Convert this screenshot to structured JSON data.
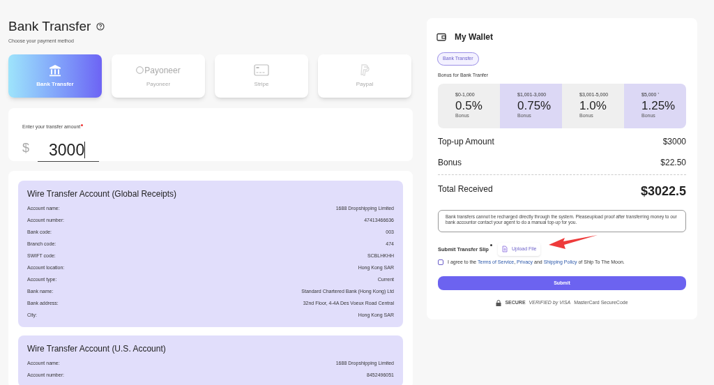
{
  "page": {
    "title": "Bank Transfer",
    "subtitle": "Choose your payment method"
  },
  "methods": [
    {
      "kind": "bank",
      "label": "Bank Transfer",
      "selected": true
    },
    {
      "kind": "payoneer",
      "logo_text": "Payoneer",
      "label": "Payoneer",
      "selected": false
    },
    {
      "kind": "stripe",
      "label": "Stripe",
      "selected": false
    },
    {
      "kind": "paypal",
      "label": "Paypal",
      "selected": false
    }
  ],
  "amount": {
    "label": "Enter your transfer amount",
    "required": true,
    "currency": "$",
    "value": "3000"
  },
  "accounts": [
    {
      "title": "Wire Transfer Account (Global Receipts)",
      "rows": [
        {
          "label": "Account name:",
          "value": "1688 Dropshipping Limited"
        },
        {
          "label": "Account number:",
          "value": "47413466636"
        },
        {
          "label": "Bank code:",
          "value": "003"
        },
        {
          "label": "Branch code:",
          "value": "474"
        },
        {
          "label": "SWIFT code:",
          "value": "SCBLHKHH"
        },
        {
          "label": "Account location:",
          "value": "Hong Kong SAR"
        },
        {
          "label": "Account type:",
          "value": "Current"
        },
        {
          "label": "Bank name:",
          "value": "Standard Chartered Bank (Hong Kong) Ltd"
        },
        {
          "label": "Bank address:",
          "value": "32nd Floor, 4-4A Des Voeux Road Central"
        },
        {
          "label": "City:",
          "value": "Hong Kong SAR"
        }
      ]
    },
    {
      "title": "Wire Transfer Account (U.S. Account)",
      "rows": [
        {
          "label": "Account name:",
          "value": "1688 Dropshipping Limited"
        },
        {
          "label": "Account number:",
          "value": "8452496051"
        }
      ]
    }
  ],
  "wallet": {
    "title": "My Wallet",
    "method_tag": "Bank Transfer",
    "bonus_title": "Bonus for Bank Tranfer",
    "tiers": [
      {
        "range": "$0-1,000",
        "rate": "0.5%",
        "caption": "Bonus",
        "color": "#efefef"
      },
      {
        "range": "$1,001-3,000",
        "rate": "0.75%",
        "caption": "Bonus",
        "color": "#dcd8f5"
      },
      {
        "range": "$3,001-5,000",
        "rate": "1.0%",
        "caption": "Bonus",
        "color": "#efefef"
      },
      {
        "range": "$5,000 ⁺",
        "rate": "1.25%",
        "caption": "Bonus",
        "color": "#dcd8f5"
      }
    ],
    "topup_label": "Top-up Amount",
    "topup_value": "$3000",
    "bonus_label": "Bonus",
    "bonus_value": "$22.50",
    "total_label": "Total Received",
    "total_value": "$3022.5",
    "notice": "Bank transfers cannot be recharged directly through the system. Pleaseupload proof after transferring money to our bank accountor contact your agent to do a manual top-up for you.",
    "slip_label": "Submit Transfer Slip",
    "slip_required": true,
    "upload_label": "Upload File",
    "agree": {
      "checked": false,
      "parts": [
        {
          "kind": "text",
          "text": "I agree to the "
        },
        {
          "kind": "link",
          "text": "Terms of Service"
        },
        {
          "kind": "text",
          "text": ", "
        },
        {
          "kind": "link",
          "text": "Privacy"
        },
        {
          "kind": "text",
          "text": " and "
        },
        {
          "kind": "link",
          "text": "Shipping Policy"
        },
        {
          "kind": "text",
          "text": " of Ship To The Moon."
        }
      ]
    },
    "submit": "Submit",
    "badges": [
      {
        "kind": "secure",
        "text": "SECURE"
      },
      {
        "kind": "visa",
        "text": "VERIFIED by VISA"
      },
      {
        "kind": "mastercard",
        "text": "MasterCard SecureCode"
      }
    ]
  }
}
